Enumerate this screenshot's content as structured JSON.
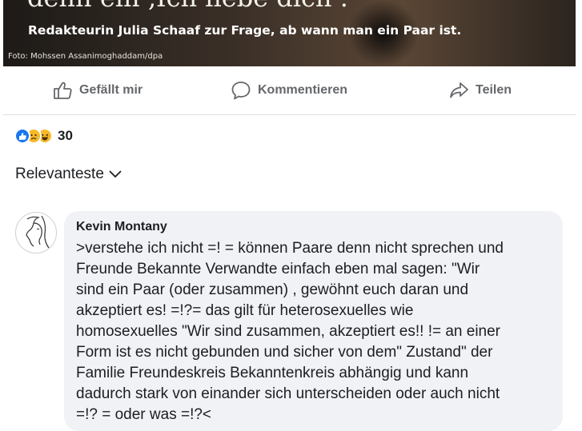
{
  "post_image": {
    "quote_text": "denn ein ‚Ich liebe dich‘.",
    "caption": "Redakteurin Julia Schaaf zur Frage, ab wann man ein Paar ist.",
    "credit": "Foto: Mohssen Assanimoghaddam/dpa"
  },
  "actions": {
    "like_label": "Gefällt mir",
    "like_icon": "thumbs-up-icon",
    "comment_label": "Kommentieren",
    "comment_icon": "speech-bubble-icon",
    "share_label": "Teilen",
    "share_icon": "share-arrow-icon"
  },
  "reactions": {
    "icons": [
      "like-icon",
      "sad-icon",
      "haha-icon"
    ],
    "count": "30"
  },
  "sort": {
    "label": "Relevanteste",
    "icon": "chevron-down-icon"
  },
  "comment": {
    "author": "Kevin Montany",
    "lines": [
      ">verstehe ich nicht =! = können Paare denn nicht sprechen und",
      "Freunde Bekannte Verwandte einfach eben mal  sagen: \"Wir",
      "sind ein Paar (oder zusammen) , gewöhnt euch daran und",
      "akzeptiert es! =!?= das gilt für heterosexuelles wie",
      "homosexuelles \"Wir sind zusammen, akzeptiert es!! != an einer",
      "Form ist es nicht gebunden und sicher von dem\" Zustand\" der",
      "Familie Freundeskreis Bekanntenkreis abhängig und kann",
      "dadurch stark von einander sich unterscheiden oder auch nicht",
      "=!? = oder was =!?<"
    ]
  },
  "colors": {
    "accent": "#1877f2",
    "muted_text": "#65676b",
    "bubble": "#f0f2f5"
  }
}
